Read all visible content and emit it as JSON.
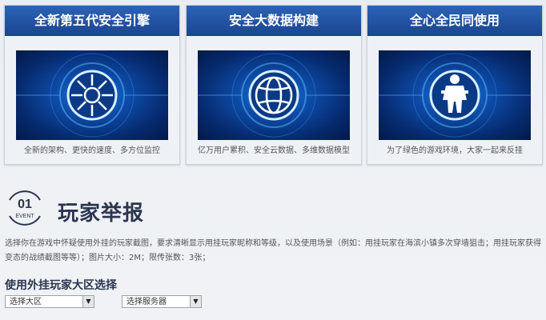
{
  "cards": [
    {
      "title": "全新第五代安全引擎",
      "caption": "全新的架构、更快的速度、多方位监控",
      "icon": "engine-sun-icon"
    },
    {
      "title": "安全大数据构建",
      "caption": "亿万用户累积、安全云数据、多维数据模型",
      "icon": "globe-icon"
    },
    {
      "title": "全心全民同使用",
      "caption": "为了绿色的游戏环境，大家一起来反挂",
      "icon": "soldier-icon"
    }
  ],
  "event": {
    "number": "01",
    "label": "EVENT",
    "title": "玩家举报",
    "description": "选择你在游戏中怀疑使用外挂的玩家截图，要求清晰显示用挂玩家昵称和等级，以及使用场景（例如：用挂玩家在海滨小镇多次穿墙狙击；用挂玩家获得变态的战绩截图等等）；图片大小：2M；限传张数：3张；"
  },
  "region": {
    "title": "使用外挂玩家大区选择",
    "select_area": "选择大区",
    "select_server": "选择服务器"
  }
}
